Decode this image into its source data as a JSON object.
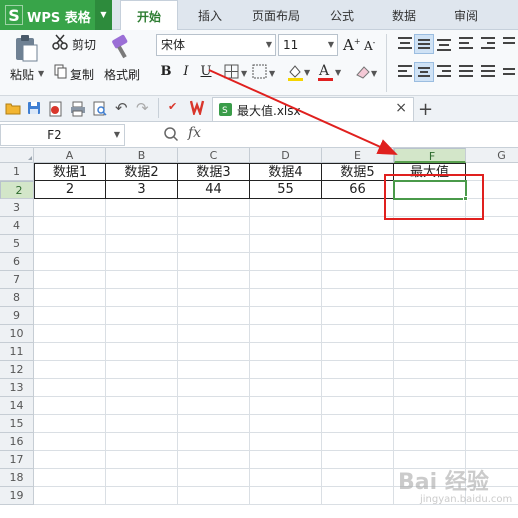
{
  "app": {
    "logo_letter": "S",
    "title": "WPS 表格"
  },
  "menu": {
    "tabs": [
      {
        "label": "开始",
        "active": true
      },
      {
        "label": "插入",
        "active": false
      },
      {
        "label": "页面布局",
        "active": false
      },
      {
        "label": "公式",
        "active": false
      },
      {
        "label": "数据",
        "active": false
      },
      {
        "label": "审阅",
        "active": false
      }
    ]
  },
  "ribbon": {
    "cut_label": "剪切",
    "paste_label": "粘贴",
    "copy_label": "复制",
    "format_painter_label": "格式刷",
    "font_name": "宋体",
    "font_size": "11",
    "bold": "B",
    "italic": "I",
    "underline": "U",
    "grow_font": "A",
    "shrink_font": "A"
  },
  "document": {
    "filename": "最大值.xlsx",
    "close": "×",
    "new_tab": "+"
  },
  "formula_bar": {
    "name_box": "F2",
    "fx": "fx",
    "content": ""
  },
  "sheet": {
    "columns": [
      "A",
      "B",
      "C",
      "D",
      "E",
      "F",
      "G"
    ],
    "selected_column": "F",
    "rows": [
      "1",
      "2",
      "3",
      "4",
      "5",
      "6",
      "7",
      "8",
      "9",
      "10",
      "11",
      "12",
      "13",
      "14",
      "15",
      "16",
      "17",
      "18",
      "19"
    ],
    "selected_row": "2",
    "cells": {
      "A1": "数据1",
      "B1": "数据2",
      "C1": "数据3",
      "D1": "数据4",
      "E1": "数据5",
      "F1": "最大值",
      "A2": "2",
      "B2": "3",
      "C2": "44",
      "D2": "55",
      "E2": "66",
      "F2": ""
    },
    "active_cell": "F2"
  },
  "annotation": {
    "color": "#e0201e"
  },
  "watermark": {
    "text": "Bai 经验",
    "subtext": "jingyan.baidu.com"
  }
}
